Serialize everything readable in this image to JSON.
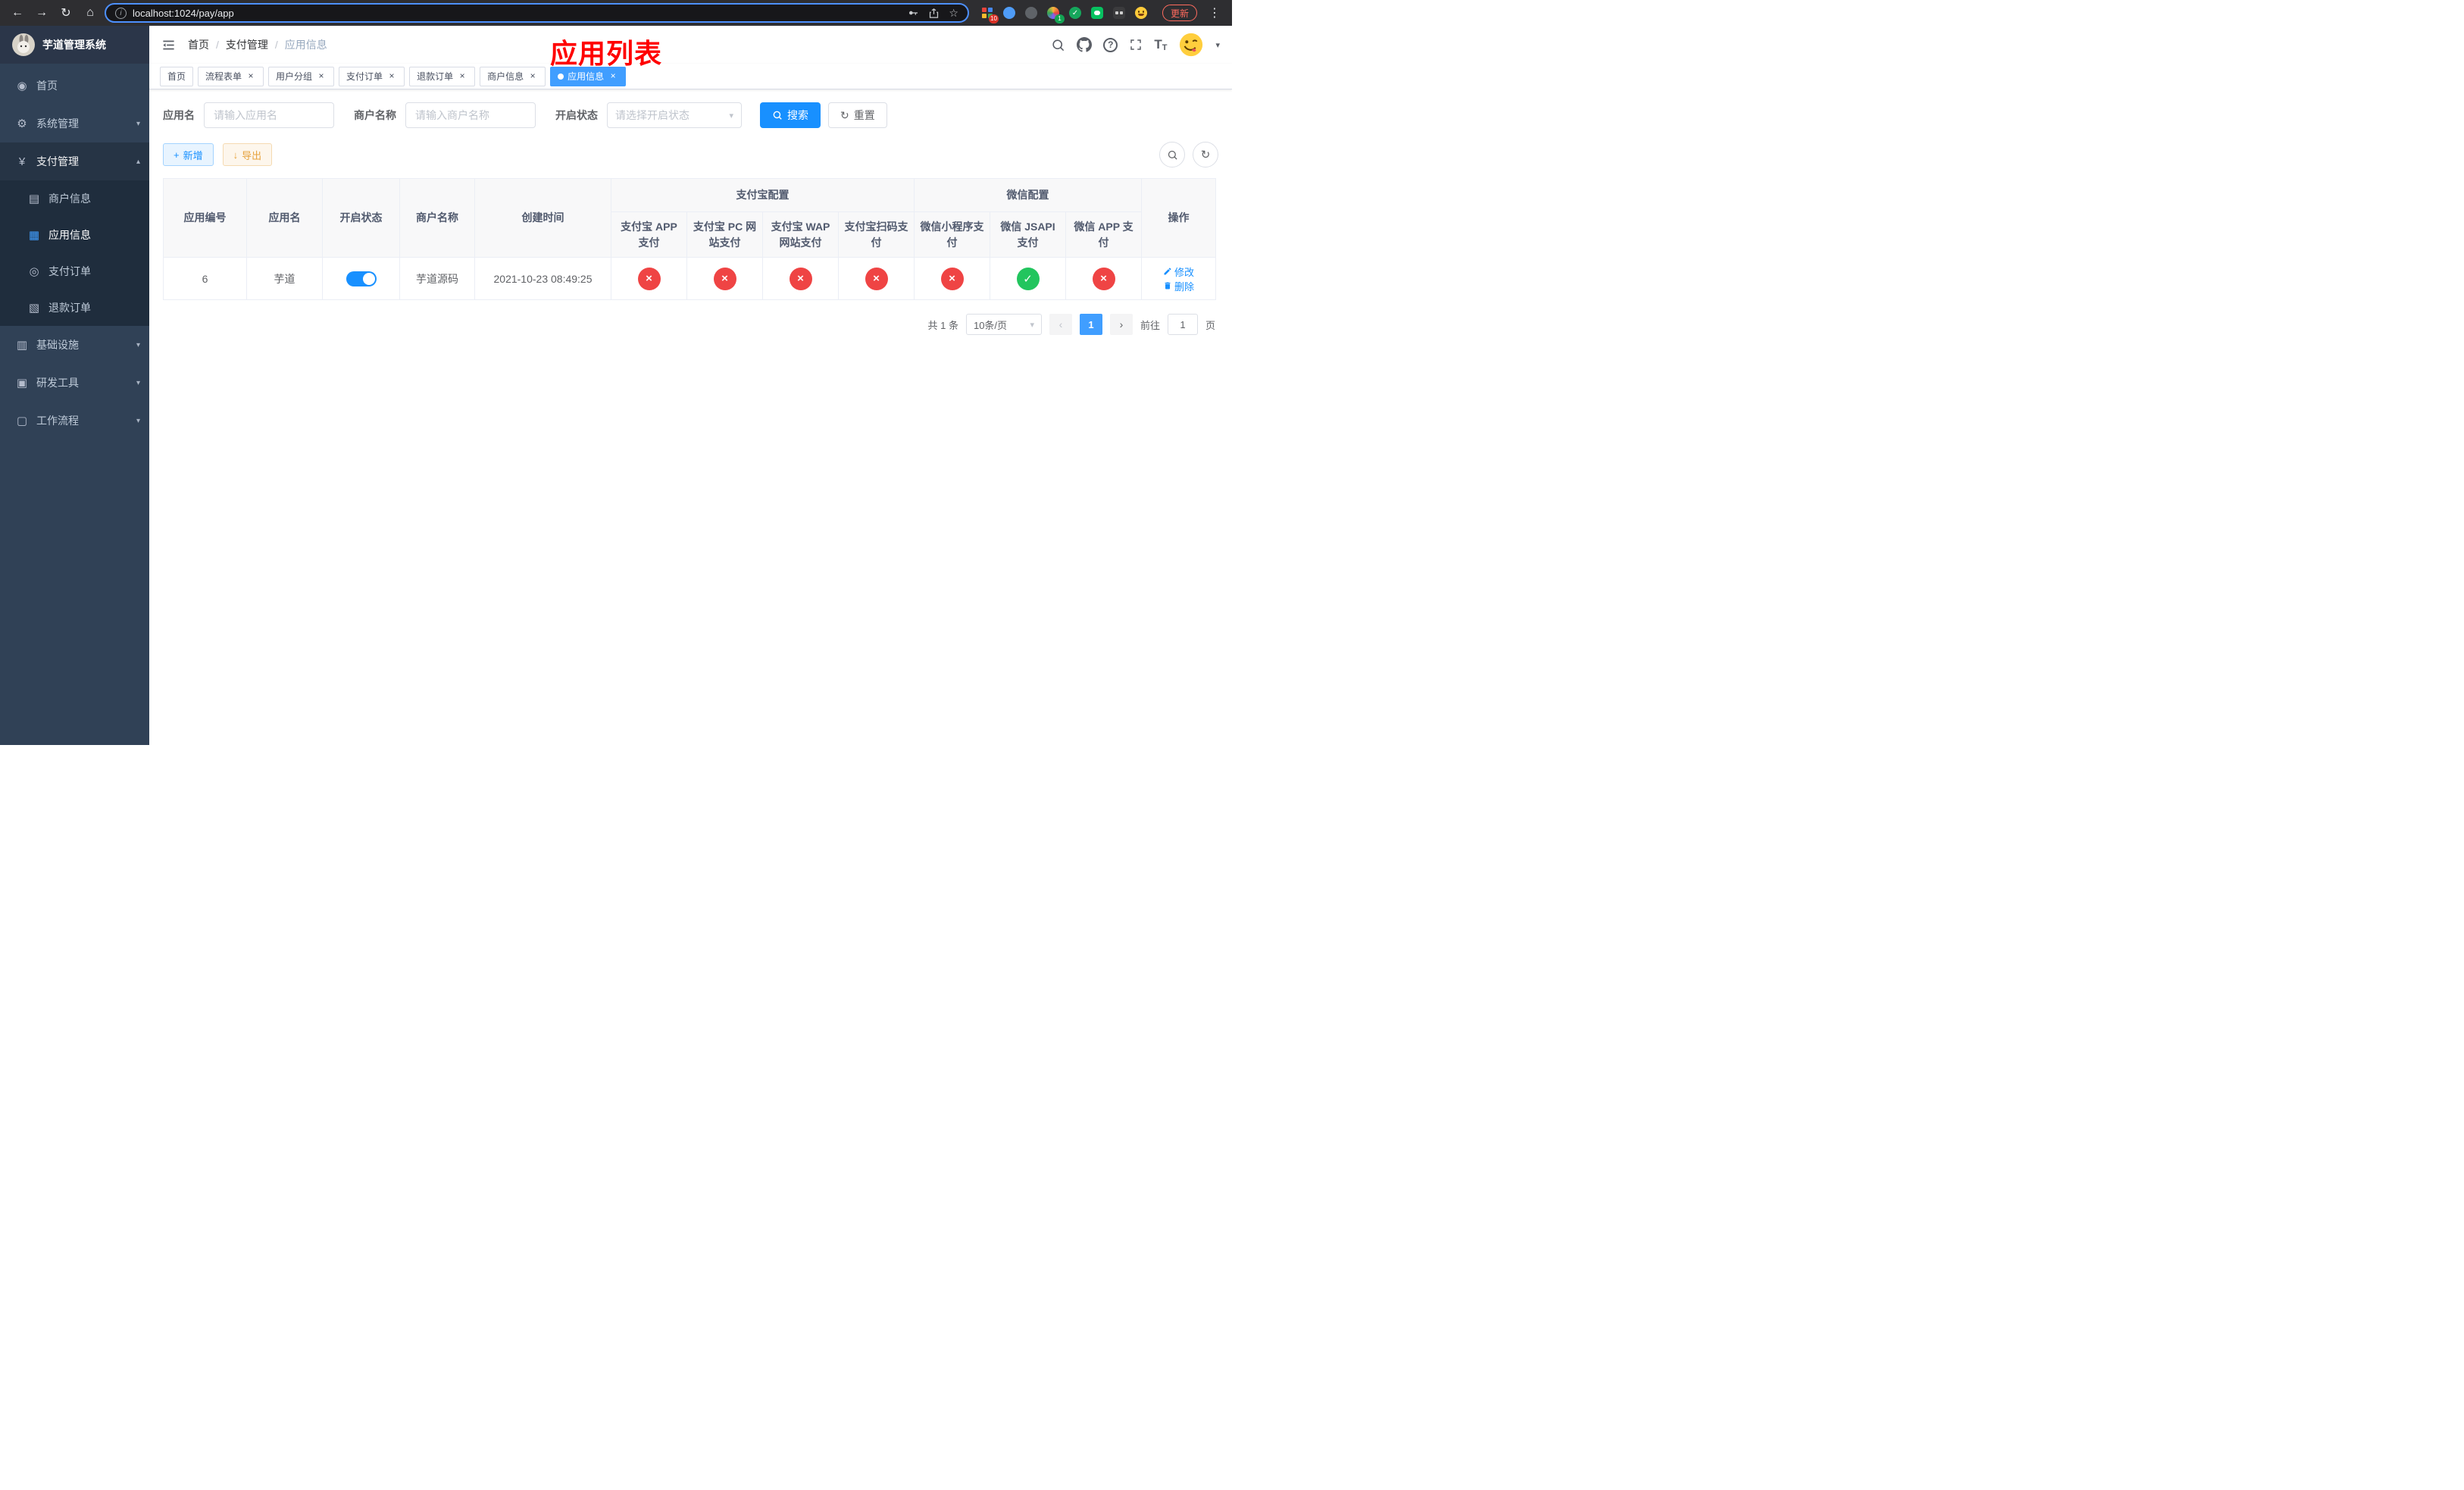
{
  "browser": {
    "url": "localhost:1024/pay/app",
    "ext_badge_grid": "10",
    "ext_badge_avatar": "1",
    "update_label": "更新"
  },
  "icons": {
    "back": "←",
    "forward": "→",
    "reload": "↻",
    "home": "⌂",
    "info": "i",
    "star": "☆",
    "menu_dots": "⋮",
    "caret_down": "▾",
    "plus": "+",
    "download": "↓",
    "refresh": "↻",
    "close": "×",
    "check": "✓",
    "cross": "×",
    "prev": "‹",
    "next": "›",
    "question": "?",
    "font_large": "T",
    "font_small": "T"
  },
  "sidebar": {
    "title": "芋道管理系统",
    "items": [
      {
        "label": "首页",
        "glyph": "◉",
        "arrow": ""
      },
      {
        "label": "系统管理",
        "glyph": "⚙",
        "arrow": "▾"
      },
      {
        "label": "支付管理",
        "glyph": "¥",
        "arrow": "▴"
      },
      {
        "label": "基础设施",
        "glyph": "▥",
        "arrow": "▾"
      },
      {
        "label": "研发工具",
        "glyph": "▣",
        "arrow": "▾"
      },
      {
        "label": "工作流程",
        "glyph": "▢",
        "arrow": "▾"
      }
    ],
    "submenu": [
      {
        "label": "商户信息",
        "glyph": "▤"
      },
      {
        "label": "应用信息",
        "glyph": "▦"
      },
      {
        "label": "支付订单",
        "glyph": "◎"
      },
      {
        "label": "退款订单",
        "glyph": "▧"
      }
    ]
  },
  "header": {
    "breadcrumb": [
      "首页",
      "支付管理",
      "应用信息"
    ],
    "annotation": "应用列表"
  },
  "tabs": [
    {
      "label": "首页"
    },
    {
      "label": "流程表单"
    },
    {
      "label": "用户分组"
    },
    {
      "label": "支付订单"
    },
    {
      "label": "退款订单"
    },
    {
      "label": "商户信息"
    },
    {
      "label": "应用信息"
    }
  ],
  "filters": {
    "app_name": {
      "label": "应用名",
      "placeholder": "请输入应用名",
      "value": ""
    },
    "merchant_name": {
      "label": "商户名称",
      "placeholder": "请输入商户名称",
      "value": ""
    },
    "status": {
      "label": "开启状态",
      "placeholder": "请选择开启状态"
    },
    "search_label": "搜索",
    "reset_label": "重置"
  },
  "toolbar": {
    "add_label": "新增",
    "export_label": "导出"
  },
  "table": {
    "columns": [
      "应用编号",
      "应用名",
      "开启状态",
      "商户名称",
      "创建时间"
    ],
    "groups": [
      {
        "label": "支付宝配置",
        "children": [
          "支付宝 APP 支付",
          "支付宝 PC 网站支付",
          "支付宝 WAP 网站支付",
          "支付宝扫码支付"
        ]
      },
      {
        "label": "微信配置",
        "children": [
          "微信小程序支付",
          "微信 JSAPI 支付",
          "微信 APP 支付"
        ]
      }
    ],
    "action_column": "操作",
    "rows": [
      {
        "id": "6",
        "name": "芋道",
        "enabled": true,
        "merchant": "芋道源码",
        "created_at": "2021-10-23 08:49:25",
        "configs": [
          false,
          false,
          false,
          false,
          false,
          true,
          false
        ],
        "edit_label": "修改",
        "delete_label": "删除"
      }
    ]
  },
  "pagination": {
    "total_text": "共 1 条",
    "page_size_text": "10条/页",
    "current_page": "1",
    "goto_prefix": "前往",
    "goto_value": "1",
    "goto_suffix": "页"
  },
  "colors": {
    "primary": "#1890ff",
    "menu_active": "#409eff",
    "success": "#22c55e",
    "danger": "#ef4444",
    "sidebar_bg": "#304156",
    "submenu_bg": "#1f2d3d",
    "annotation": "#ff0000"
  }
}
